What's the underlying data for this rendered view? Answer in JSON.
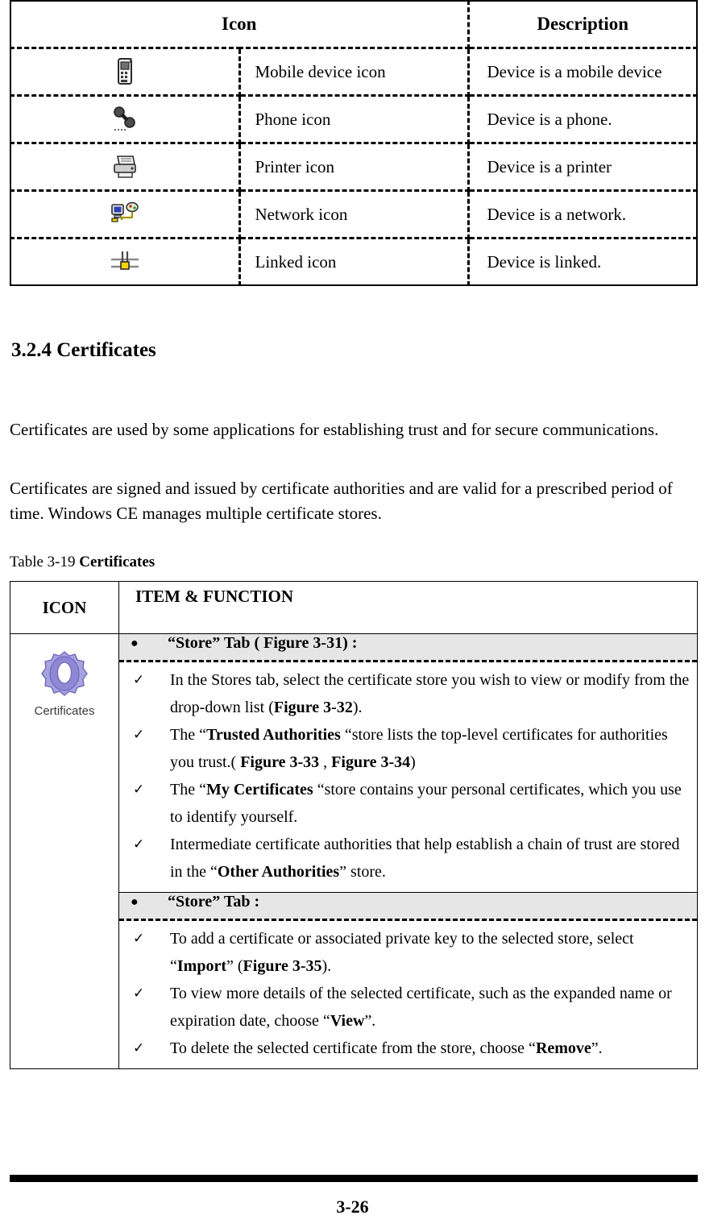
{
  "device_table": {
    "headers": [
      "Icon",
      "Description"
    ],
    "rows": [
      {
        "icon": "mobile-device-icon",
        "name": "Mobile device icon",
        "description": "Device is a mobile device"
      },
      {
        "icon": "phone-icon",
        "name": "Phone icon",
        "description": "Device is a phone."
      },
      {
        "icon": "printer-icon",
        "name": "Printer icon",
        "description": "Device is a printer"
      },
      {
        "icon": "network-icon",
        "name": "Network icon",
        "description": "Device is a network."
      },
      {
        "icon": "linked-icon",
        "name": "Linked icon",
        "description": "Device is linked."
      }
    ]
  },
  "section": {
    "heading": "3.2.4 Certificates",
    "paragraph_1": "Certificates are used by some applications for establishing trust and for secure communications.",
    "paragraph_2": "Certificates are signed and issued by certificate authorities and are valid for a prescribed period of time. Windows CE manages multiple certificate stores.",
    "table_caption_prefix": "Table 3-19 ",
    "table_caption_title": "Certificates"
  },
  "cert_table": {
    "headers": [
      "ICON",
      "ITEM & FUNCTION"
    ],
    "icon": {
      "name": "certificates-icon",
      "label": "Certificates",
      "color": "#9a95d6"
    },
    "groups": [
      {
        "subhead": {
          "bullet": "●",
          "quote_open": "“",
          "bold_text": "Store",
          "quote_close": "”",
          "tab_word": " Tab",
          "suffix_open": " ( ",
          "figure_ref": "Figure 3-31",
          "suffix_close": ") :"
        },
        "items": [
          {
            "mark": "✓",
            "parts": [
              {
                "t": "In the Stores tab, select the certificate store you wish to view or modify from the drop-down list (",
                "b": false
              },
              {
                "t": "Figure 3-32",
                "b": true
              },
              {
                "t": ").",
                "b": false
              }
            ]
          },
          {
            "mark": "✓",
            "parts": [
              {
                "t": "The “",
                "b": false
              },
              {
                "t": "Trusted Authorities",
                "b": true
              },
              {
                "t": " “store lists the top-level certificates for authorities you trust.( ",
                "b": false
              },
              {
                "t": "Figure 3-33",
                "b": true
              },
              {
                "t": " , ",
                "b": false
              },
              {
                "t": "Figure 3-34",
                "b": true
              },
              {
                "t": ")",
                "b": false
              }
            ]
          },
          {
            "mark": "✓",
            "parts": [
              {
                "t": "The “",
                "b": false
              },
              {
                "t": "My Certificates",
                "b": true
              },
              {
                "t": " “store contains your personal certificates, which you use to identify yourself.",
                "b": false
              }
            ]
          },
          {
            "mark": "✓",
            "parts": [
              {
                "t": "Intermediate certificate authorities that help establish a chain of trust are stored in the “",
                "b": false
              },
              {
                "t": "Other Authorities",
                "b": true
              },
              {
                "t": "” store.",
                "b": false
              }
            ]
          }
        ]
      },
      {
        "subhead": {
          "bullet": "●",
          "quote_open": "“",
          "bold_text": "Store",
          "quote_close": "”",
          "tab_word": " Tab",
          "suffix_open": "",
          "figure_ref": "",
          "suffix_close": " :"
        },
        "items": [
          {
            "mark": "✓",
            "parts": [
              {
                "t": "To add a certificate or associated private key to the selected store, select “",
                "b": false
              },
              {
                "t": "Import",
                "b": true
              },
              {
                "t": "” (",
                "b": false
              },
              {
                "t": "Figure 3-35",
                "b": true
              },
              {
                "t": ").",
                "b": false
              }
            ]
          },
          {
            "mark": "✓",
            "parts": [
              {
                "t": "To view more details of the selected certificate, such as the expanded name or expiration date, choose “",
                "b": false
              },
              {
                "t": "View",
                "b": true
              },
              {
                "t": "”.",
                "b": false
              }
            ]
          },
          {
            "mark": "✓",
            "parts": [
              {
                "t": "To delete the selected certificate from the store, choose “",
                "b": false
              },
              {
                "t": "Remove",
                "b": true
              },
              {
                "t": "”.",
                "b": false
              }
            ]
          }
        ]
      }
    ]
  },
  "footer": {
    "page_number": "3-26"
  }
}
